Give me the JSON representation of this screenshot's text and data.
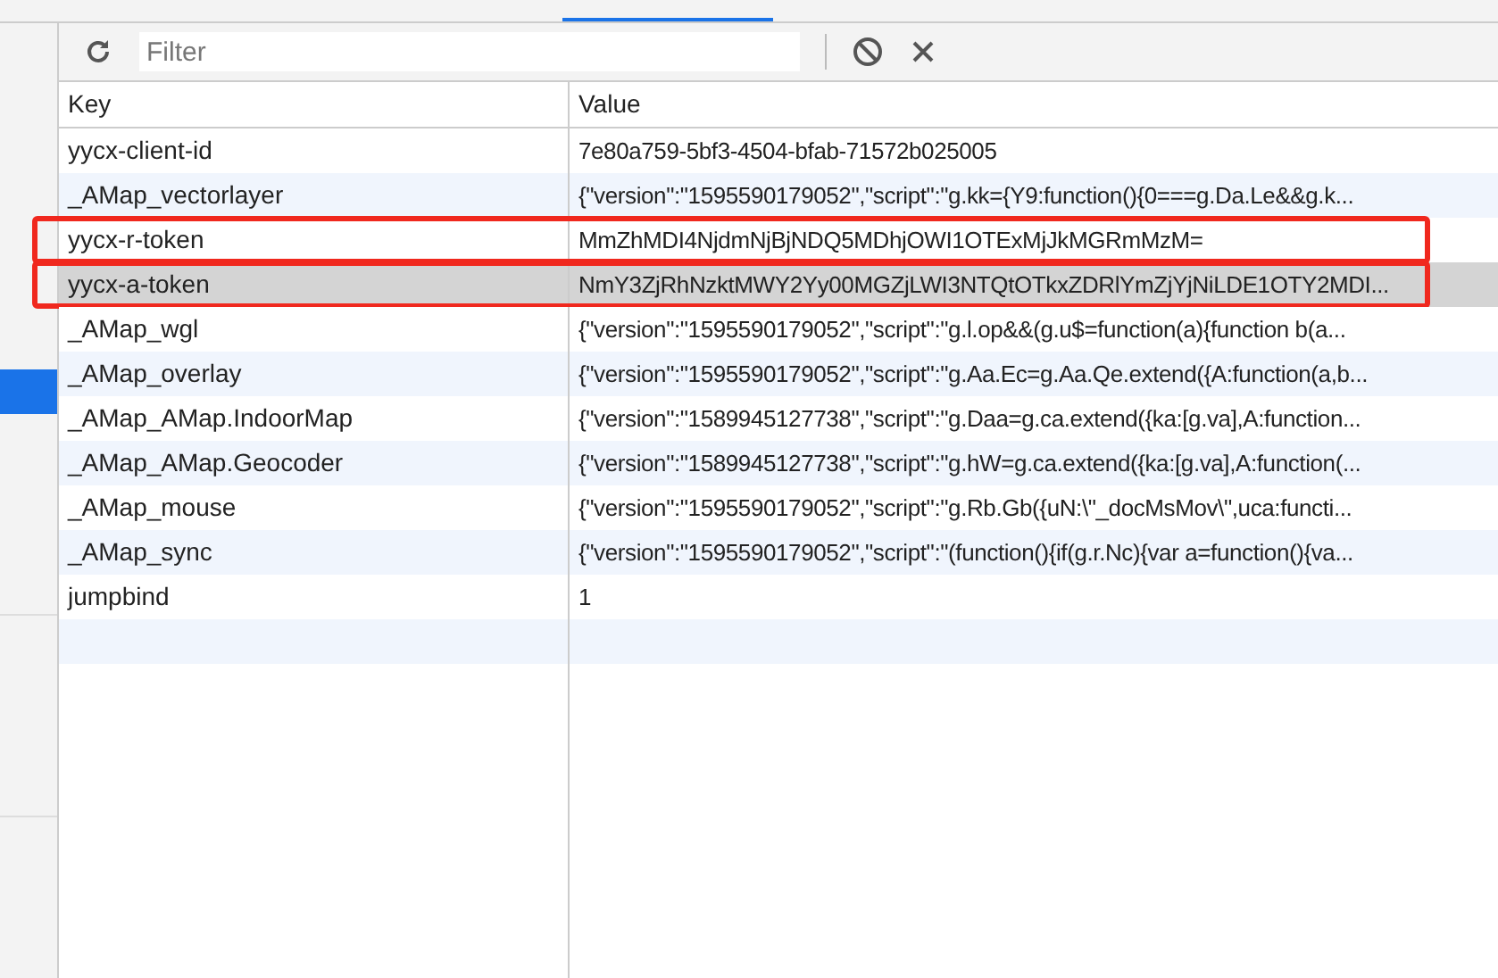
{
  "toolbar": {
    "filter_placeholder": "Filter"
  },
  "sidebar": {
    "items": [
      {
        "selected": true
      },
      {
        "selected": false
      },
      {
        "selected": false
      }
    ]
  },
  "table": {
    "columns": [
      "Key",
      "Value"
    ],
    "rows": [
      {
        "key": "yycx-client-id",
        "value": "7e80a759-5bf3-4504-bfab-71572b025005",
        "selected": false,
        "highlighted": false
      },
      {
        "key": "_AMap_vectorlayer",
        "value": "{\"version\":\"1595590179052\",\"script\":\"g.kk={Y9:function(){0===g.Da.Le&&g.k...",
        "selected": false,
        "highlighted": false
      },
      {
        "key": "yycx-r-token",
        "value": "MmZhMDI4NjdmNjBjNDQ5MDhjOWI1OTExMjJkMGRmMzM=",
        "selected": false,
        "highlighted": true
      },
      {
        "key": "yycx-a-token",
        "value": "NmY3ZjRhNzktMWY2Yy00MGZjLWI3NTQtOTkxZDRlYmZjYjNiLDE1OTY2MDI...",
        "selected": true,
        "highlighted": true
      },
      {
        "key": "_AMap_wgl",
        "value": "{\"version\":\"1595590179052\",\"script\":\"g.l.op&&(g.u$=function(a){function b(a...",
        "selected": false,
        "highlighted": false
      },
      {
        "key": "_AMap_overlay",
        "value": "{\"version\":\"1595590179052\",\"script\":\"g.Aa.Ec=g.Aa.Qe.extend({A:function(a,b...",
        "selected": false,
        "highlighted": false
      },
      {
        "key": "_AMap_AMap.IndoorMap",
        "value": "{\"version\":\"1589945127738\",\"script\":\"g.Daa=g.ca.extend({ka:[g.va],A:function...",
        "selected": false,
        "highlighted": false
      },
      {
        "key": "_AMap_AMap.Geocoder",
        "value": "{\"version\":\"1589945127738\",\"script\":\"g.hW=g.ca.extend({ka:[g.va],A:function(...",
        "selected": false,
        "highlighted": false
      },
      {
        "key": "_AMap_mouse",
        "value": "{\"version\":\"1595590179052\",\"script\":\"g.Rb.Gb({uN:\\\"_docMsMov\\\",uca:functi...",
        "selected": false,
        "highlighted": false
      },
      {
        "key": "_AMap_sync",
        "value": "{\"version\":\"1595590179052\",\"script\":\"(function(){if(g.r.Nc){var a=function(){va...",
        "selected": false,
        "highlighted": false
      },
      {
        "key": "jumpbind",
        "value": "1",
        "selected": false,
        "highlighted": false
      }
    ]
  }
}
